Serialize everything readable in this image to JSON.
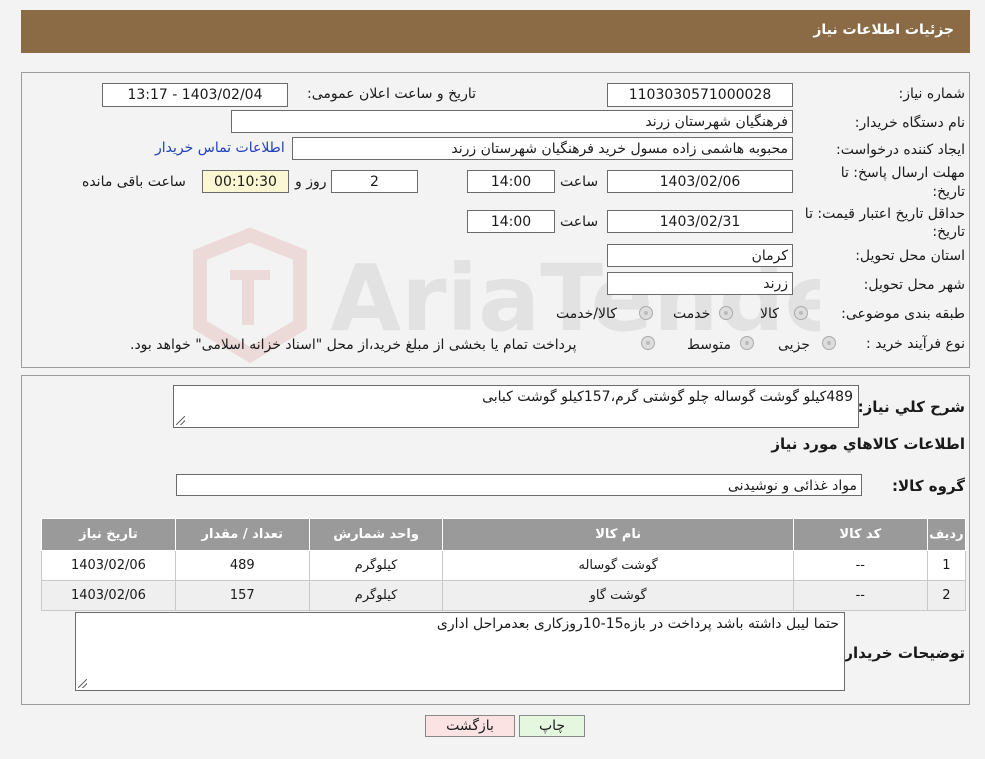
{
  "header": {
    "title": "جزئیات اطلاعات نیاز"
  },
  "watermark": {
    "text": "AriaTender.neT"
  },
  "details": {
    "need_number_label": "شماره نیاز:",
    "need_number": "1103030571000028",
    "announce_label": "تاریخ و ساعت اعلان عمومی:",
    "announce_value": "1403/02/04 - 13:17",
    "buyer_org_label": "نام دستگاه خریدار:",
    "buyer_org": "فرهنگیان شهرستان زرند",
    "requester_label": "ایجاد کننده درخواست:",
    "requester": "محبوبه هاشمی زاده مسول خرید فرهنگیان شهرستان زرند",
    "contact_link": "اطلاعات تماس خریدار",
    "deadline_label_1": "مهلت ارسال پاسخ: تا",
    "deadline_label_2": "تاریخ:",
    "deadline_date": "1403/02/06",
    "time_label": "ساعت",
    "deadline_time": "14:00",
    "days": "2",
    "days_label": "روز و",
    "remaining": "00:10:30",
    "remaining_label": "ساعت باقی مانده",
    "validity_label_1": "حداقل تاریخ اعتبار قیمت: تا",
    "validity_label_2": "تاریخ:",
    "validity_date": "1403/02/31",
    "validity_time": "14:00",
    "province_label": "استان محل تحویل:",
    "province": "کرمان",
    "city_label": "شهر محل تحویل:",
    "city": "زرند",
    "category_label": "طبقه بندی موضوعی:",
    "category_options": [
      "کالا",
      "خدمت",
      "کالا/خدمت"
    ],
    "process_label": "نوع فرآیند خرید :",
    "process_options": [
      "جزیی",
      "متوسط"
    ],
    "process_note": "پرداخت تمام یا بخشی از مبلغ خرید،از محل \"اسناد خزانه اسلامی\" خواهد بود."
  },
  "summary": {
    "description_label": "شرح کلي نياز:",
    "description": "489کیلو گوشت گوساله چلو گوشتی گرم،157کیلو گوشت کبابی",
    "goods_info_title": "اطلاعات کالاهاي مورد نياز",
    "goods_group_label": "گروه کالا:",
    "goods_group": "مواد غذائی و نوشیدنی"
  },
  "table": {
    "headers": [
      "ردیف",
      "کد کالا",
      "نام کالا",
      "واحد شمارش",
      "تعداد / مقدار",
      "تاریخ نیاز"
    ],
    "rows": [
      [
        "1",
        "--",
        "گوشت گوساله",
        "کیلوگرم",
        "489",
        "1403/02/06"
      ],
      [
        "2",
        "--",
        "گوشت گاو",
        "کیلوگرم",
        "157",
        "1403/02/06"
      ]
    ]
  },
  "buyer_notes": {
    "label": "توضیحات خریدار:",
    "text": "حتما لیبل داشته باشد پرداخت در بازه15-10روزکاری بعدمراحل اداری"
  },
  "buttons": {
    "print": "چاپ",
    "back": "بازگشت"
  },
  "colors": {
    "header_bg": "#8b6b45",
    "table_header_bg": "#9a9a9a",
    "print_bg": "#e6f7e0",
    "back_bg": "#fbe3e3",
    "remaining_bg": "#fbf7d3",
    "link": "#1f3fbf"
  }
}
